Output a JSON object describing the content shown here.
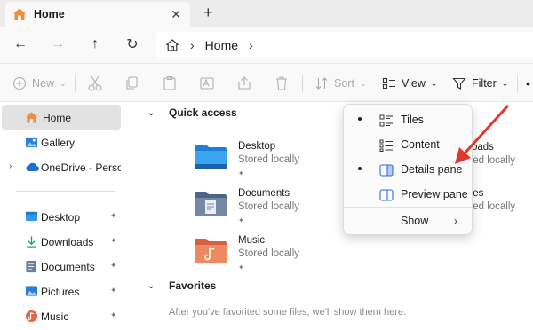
{
  "tab": {
    "label": "Home",
    "close_glyph": "✕",
    "new_tab_glyph": "+"
  },
  "nav": {
    "back": "←",
    "forward": "→",
    "up": "↑",
    "refresh": "↻"
  },
  "address": {
    "sep1": "›",
    "location": "Home",
    "sep2": "›"
  },
  "toolbar": {
    "new_label": "New",
    "sort_label": "Sort",
    "view_label": "View",
    "filter_label": "Filter",
    "more_glyph": "•",
    "chevron": "⌄"
  },
  "sidebar": {
    "items": [
      {
        "label": "Home",
        "icon": "home-icon"
      },
      {
        "label": "Gallery",
        "icon": "gallery-icon"
      },
      {
        "label": "OneDrive - Persona",
        "icon": "cloud-icon"
      },
      {
        "label": "Desktop",
        "icon": "desktop-folder-icon"
      },
      {
        "label": "Downloads",
        "icon": "download-icon"
      },
      {
        "label": "Documents",
        "icon": "documents-icon"
      },
      {
        "label": "Pictures",
        "icon": "pictures-icon"
      },
      {
        "label": "Music",
        "icon": "music-icon"
      }
    ],
    "pin_glyph": "📌",
    "expander_glyph": "›"
  },
  "main": {
    "quick_access_title": "Quick access",
    "quick_access_items": [
      {
        "name": "Desktop",
        "status": "Stored locally"
      },
      {
        "name": "Documents",
        "status": "Stored locally"
      },
      {
        "name": "Music",
        "status": "Stored locally"
      }
    ],
    "hidden_items": [
      {
        "name_fragment": "nloads",
        "status_fragment": "ored locally"
      },
      {
        "name_fragment": "ures",
        "status_fragment": "ored locally"
      }
    ],
    "favorites_title": "Favorites",
    "favorites_empty": "After you've favorited some files, we'll show them here.",
    "section_chevron": "⌄",
    "pin_glyph": "📌"
  },
  "view_menu": {
    "items": [
      {
        "label": "Tiles",
        "selected": true,
        "icon": "tiles-icon"
      },
      {
        "label": "Content",
        "selected": false,
        "icon": "content-icon"
      },
      {
        "label": "Details pane",
        "selected": true,
        "icon": "details-pane-icon"
      },
      {
        "label": "Preview pane",
        "selected": false,
        "icon": "preview-pane-icon"
      },
      {
        "label": "Show",
        "selected": false,
        "submenu": true,
        "chevron": "›"
      }
    ]
  },
  "colors": {
    "accent": "#2f6fd6",
    "arrow": "#e2372f",
    "folder_blue": "#2d8fe0",
    "folder_slate": "#5b6f8c",
    "folder_orange": "#e98052"
  }
}
